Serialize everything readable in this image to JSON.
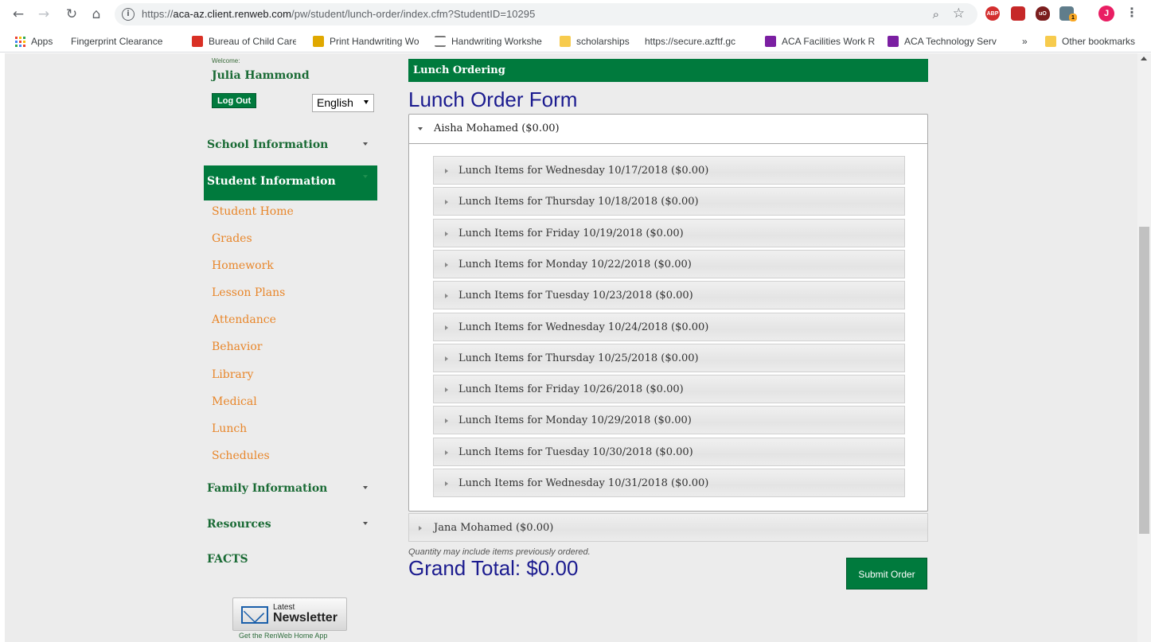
{
  "browser": {
    "url_host": "aca-az.client.renweb.com",
    "url_scheme": "https://",
    "url_path": "/pw/student/lunch-order/index.cfm?StudentID=10295",
    "profile_initial": "J",
    "extensions": [
      "ABP",
      "",
      "uO",
      "",
      "1"
    ]
  },
  "bookmarks": [
    {
      "label": "Apps",
      "icon": "apps-grid-icon"
    },
    {
      "label": "Fingerprint Clearance",
      "icon": "page-icon"
    },
    {
      "label": "Bureau of Child Care",
      "icon": "bookmark-red-icon"
    },
    {
      "label": "Print Handwriting Wo",
      "icon": "handwriting-icon"
    },
    {
      "label": "Handwriting Workshe",
      "icon": "worksheet-icon"
    },
    {
      "label": "scholarships",
      "icon": "folder-icon"
    },
    {
      "label": "https://secure.azftf.gc",
      "icon": "page-icon"
    },
    {
      "label": "ACA Facilities Work R",
      "icon": "forms-icon"
    },
    {
      "label": "ACA Technology Serv",
      "icon": "forms-icon"
    },
    {
      "label": "»",
      "icon": ""
    },
    {
      "label": "Other bookmarks",
      "icon": "folder-icon"
    }
  ],
  "sidebar": {
    "welcome": "Welcome:",
    "user_name": "Julia Hammond",
    "logout_label": "Log Out",
    "language": "English",
    "sections": [
      {
        "label": "School Information"
      },
      {
        "label": "Student Information"
      },
      {
        "label": "Family Information"
      },
      {
        "label": "Resources"
      },
      {
        "label": "FACTS"
      }
    ],
    "student_items": [
      "Student Home",
      "Grades",
      "Homework",
      "Lesson Plans",
      "Attendance",
      "Behavior",
      "Library",
      "Medical",
      "Lunch",
      "Schedules"
    ],
    "newsletter_small": "Latest",
    "newsletter_big": "Newsletter",
    "app_link": "Get the RenWeb Home App"
  },
  "main": {
    "header": "Lunch Ordering",
    "title": "Lunch Order Form",
    "student_expanded": "Aisha Mohamed ($0.00)",
    "days": [
      "Lunch Items for Wednesday 10/17/2018 ($0.00)",
      "Lunch Items for Thursday 10/18/2018 ($0.00)",
      "Lunch Items for Friday 10/19/2018 ($0.00)",
      "Lunch Items for Monday 10/22/2018 ($0.00)",
      "Lunch Items for Tuesday 10/23/2018 ($0.00)",
      "Lunch Items for Wednesday 10/24/2018 ($0.00)",
      "Lunch Items for Thursday 10/25/2018 ($0.00)",
      "Lunch Items for Friday 10/26/2018 ($0.00)",
      "Lunch Items for Monday 10/29/2018 ($0.00)",
      "Lunch Items for Tuesday 10/30/2018 ($0.00)",
      "Lunch Items for Wednesday 10/31/2018 ($0.00)"
    ],
    "student_collapsed": "Jana Mohamed ($0.00)",
    "note": "Quantity may include items previously ordered.",
    "grand_total": "Grand Total: $0.00",
    "submit_label": "Submit Order"
  },
  "colors": {
    "brand_green": "#007a3d",
    "title_blue": "#1b1b8f",
    "link_orange": "#e8862a"
  }
}
